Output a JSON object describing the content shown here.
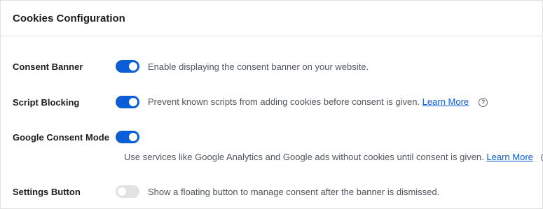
{
  "header": {
    "title": "Cookies Configuration"
  },
  "settings": [
    {
      "label": "Consent Banner",
      "enabled": true,
      "description": "Enable displaying the consent banner on your website.",
      "link": "",
      "help": false
    },
    {
      "label": "Script Blocking",
      "enabled": true,
      "description": "Prevent known scripts from adding cookies before consent is given.",
      "link": "Learn More",
      "help": true
    },
    {
      "label": "Google Consent Mode",
      "enabled": true,
      "description": "Use services like Google Analytics and Google ads without cookies until consent is given.",
      "link": "Learn More",
      "help": true
    },
    {
      "label": "Settings Button",
      "enabled": false,
      "description": "Show a floating button to manage consent after the banner is dismissed.",
      "link": "",
      "help": false
    }
  ],
  "colors": {
    "accent": "#0b5ed7",
    "toggle_off": "#e2e2e2",
    "border": "#e0e0e0"
  },
  "icons": {
    "help": "question-circle-icon"
  }
}
